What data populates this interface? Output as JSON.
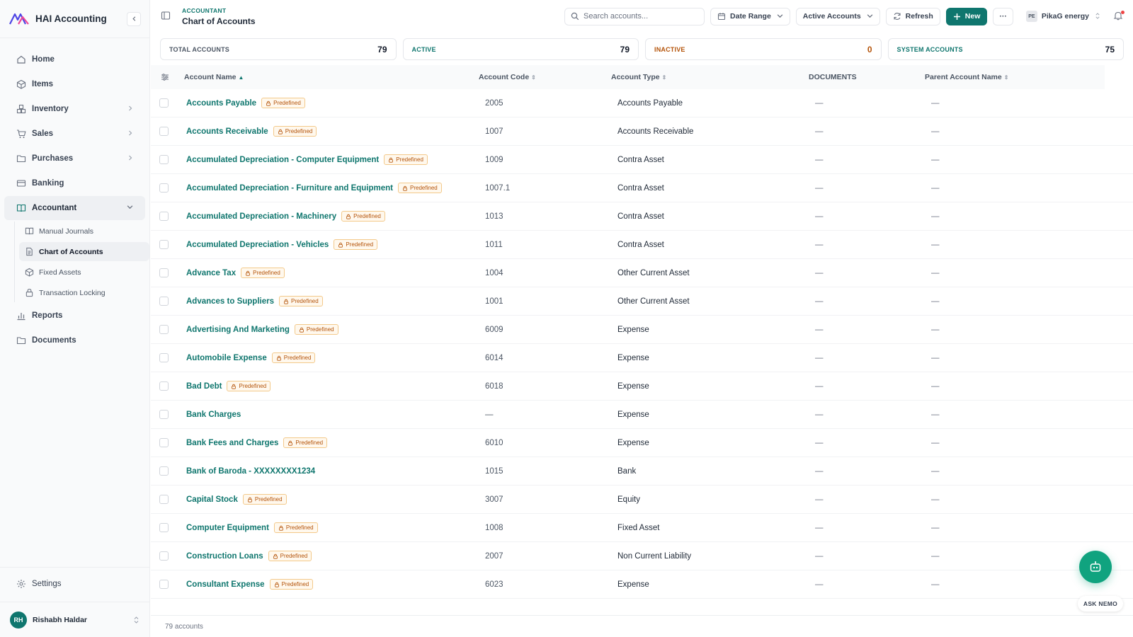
{
  "app": {
    "name": "HAI Accounting"
  },
  "colors": {
    "accent": "#0f766e",
    "badge": "#b45309",
    "nemo": "#10a37f"
  },
  "sidebar": {
    "items": [
      {
        "label": "Home",
        "icon": "home-icon"
      },
      {
        "label": "Items",
        "icon": "box-icon"
      },
      {
        "label": "Inventory",
        "icon": "boxes-icon"
      },
      {
        "label": "Sales",
        "icon": "cart-icon"
      },
      {
        "label": "Purchases",
        "icon": "folder-icon"
      },
      {
        "label": "Banking",
        "icon": "card-icon"
      },
      {
        "label": "Accountant",
        "icon": "book-icon"
      }
    ],
    "sub_items": [
      {
        "label": "Manual Journals",
        "icon": "book-open-icon"
      },
      {
        "label": "Chart of Accounts",
        "icon": "file-icon"
      },
      {
        "label": "Fixed Assets",
        "icon": "cube-icon"
      },
      {
        "label": "Transaction Locking",
        "icon": "lock-icon"
      }
    ],
    "after_items": [
      {
        "label": "Reports",
        "icon": "bar-chart-icon"
      },
      {
        "label": "Documents",
        "icon": "folder-icon"
      }
    ],
    "settings": "Settings",
    "user": {
      "initials": "RH",
      "name": "Rishabh Haldar"
    }
  },
  "header": {
    "breadcrumb": "ACCOUNTANT",
    "title": "Chart of Accounts",
    "search_placeholder": "Search accounts...",
    "date_range": "Date Range",
    "filter": "Active Accounts",
    "refresh": "Refresh",
    "new": "New",
    "more": "···",
    "org": {
      "initials": "PE",
      "name": "PikaG energy"
    }
  },
  "stats": [
    {
      "label": "TOTAL ACCOUNTS",
      "value": "79"
    },
    {
      "label": "ACTIVE",
      "value": "79"
    },
    {
      "label": "INACTIVE",
      "value": "0"
    },
    {
      "label": "SYSTEM ACCOUNTS",
      "value": "75"
    }
  ],
  "table": {
    "columns": {
      "name": "Account Name",
      "code": "Account Code",
      "type": "Account Type",
      "documents": "DOCUMENTS",
      "parent": "Parent Account Name"
    },
    "badge_label": "Predefined",
    "rows": [
      {
        "name": "Accounts Payable",
        "predefined": true,
        "code": "2005",
        "type": "Accounts Payable",
        "documents": "—",
        "parent": "—"
      },
      {
        "name": "Accounts Receivable",
        "predefined": true,
        "code": "1007",
        "type": "Accounts Receivable",
        "documents": "—",
        "parent": "—"
      },
      {
        "name": "Accumulated Depreciation - Computer Equipment",
        "predefined": true,
        "code": "1009",
        "type": "Contra Asset",
        "documents": "—",
        "parent": "—"
      },
      {
        "name": "Accumulated Depreciation - Furniture and Equipment",
        "predefined": true,
        "code": "1007.1",
        "type": "Contra Asset",
        "documents": "—",
        "parent": "—"
      },
      {
        "name": "Accumulated Depreciation - Machinery",
        "predefined": true,
        "code": "1013",
        "type": "Contra Asset",
        "documents": "—",
        "parent": "—"
      },
      {
        "name": "Accumulated Depreciation - Vehicles",
        "predefined": true,
        "code": "1011",
        "type": "Contra Asset",
        "documents": "—",
        "parent": "—"
      },
      {
        "name": "Advance Tax",
        "predefined": true,
        "code": "1004",
        "type": "Other Current Asset",
        "documents": "—",
        "parent": "—"
      },
      {
        "name": "Advances to Suppliers",
        "predefined": true,
        "code": "1001",
        "type": "Other Current Asset",
        "documents": "—",
        "parent": "—"
      },
      {
        "name": "Advertising And Marketing",
        "predefined": true,
        "code": "6009",
        "type": "Expense",
        "documents": "—",
        "parent": "—"
      },
      {
        "name": "Automobile Expense",
        "predefined": true,
        "code": "6014",
        "type": "Expense",
        "documents": "—",
        "parent": "—"
      },
      {
        "name": "Bad Debt",
        "predefined": true,
        "code": "6018",
        "type": "Expense",
        "documents": "—",
        "parent": "—"
      },
      {
        "name": "Bank Charges",
        "predefined": false,
        "code": "—",
        "type": "Expense",
        "documents": "—",
        "parent": "—"
      },
      {
        "name": "Bank Fees and Charges",
        "predefined": true,
        "code": "6010",
        "type": "Expense",
        "documents": "—",
        "parent": "—"
      },
      {
        "name": "Bank of Baroda - XXXXXXXX1234",
        "predefined": false,
        "code": "1015",
        "type": "Bank",
        "documents": "—",
        "parent": "—"
      },
      {
        "name": "Capital Stock",
        "predefined": true,
        "code": "3007",
        "type": "Equity",
        "documents": "—",
        "parent": "—"
      },
      {
        "name": "Computer Equipment",
        "predefined": true,
        "code": "1008",
        "type": "Fixed Asset",
        "documents": "—",
        "parent": "—"
      },
      {
        "name": "Construction Loans",
        "predefined": true,
        "code": "2007",
        "type": "Non Current Liability",
        "documents": "—",
        "parent": "—"
      },
      {
        "name": "Consultant Expense",
        "predefined": true,
        "code": "6023",
        "type": "Expense",
        "documents": "—",
        "parent": "—"
      }
    ],
    "footer": "79 accounts"
  },
  "nemo": {
    "label": "ASK NEMO"
  }
}
